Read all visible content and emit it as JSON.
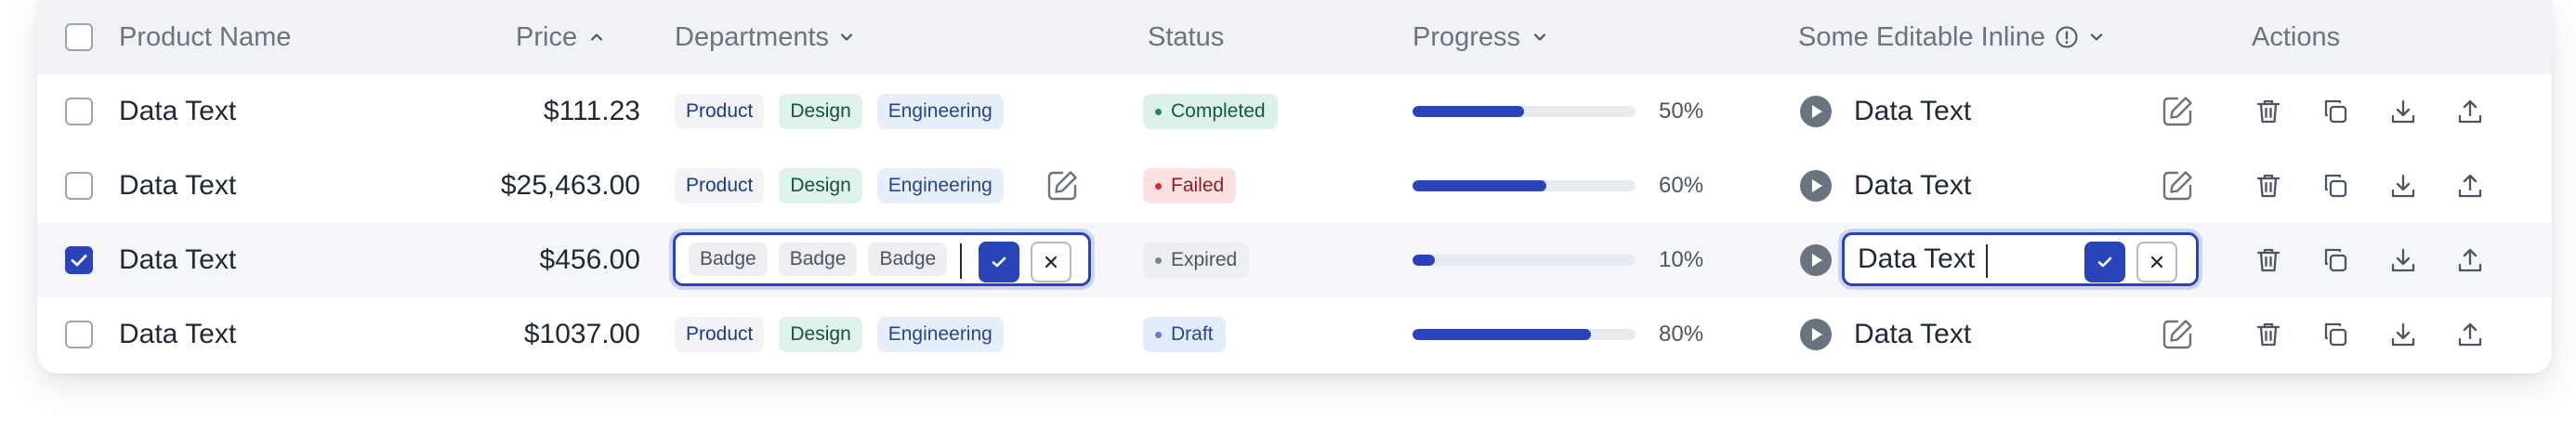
{
  "headers": {
    "product_name": "Product Name",
    "price": "Price",
    "departments": "Departments",
    "status": "Status",
    "progress": "Progress",
    "inline": "Some Editable Inline",
    "actions": "Actions"
  },
  "rows": [
    {
      "name": "Data Text",
      "price": "$111.23",
      "departments": [
        "Product",
        "Design",
        "Engineering"
      ],
      "status": "Completed",
      "progress_label": "50%",
      "progress": 0.5,
      "inline_value": "Data Text",
      "checked": false
    },
    {
      "name": "Data Text",
      "price": "$25,463.00",
      "departments": [
        "Product",
        "Design",
        "Engineering"
      ],
      "status": "Failed",
      "progress_label": "60%",
      "progress": 0.6,
      "inline_value": "Data Text",
      "checked": false
    },
    {
      "name": "Data Text",
      "price": "$456.00",
      "departments_editing": [
        "Badge",
        "Badge",
        "Badge"
      ],
      "status": "Expired",
      "progress_label": "10%",
      "progress": 0.1,
      "inline_value": "Data Text",
      "checked": true
    },
    {
      "name": "Data Text",
      "price": "$1037.00",
      "departments": [
        "Product",
        "Design",
        "Engineering"
      ],
      "status": "Draft",
      "progress_label": "80%",
      "progress": 0.8,
      "inline_value": "Data Text",
      "checked": false
    }
  ],
  "icons": {
    "sort": "chevron-up-icon",
    "dropdown": "chevron-down-icon",
    "info": "info-icon",
    "play": "play-icon",
    "edit": "edit-icon",
    "delete": "trash-icon",
    "copy": "copy-icon",
    "download": "download-icon",
    "upload": "upload-icon",
    "confirm": "check-icon",
    "cancel": "close-icon"
  },
  "colors": {
    "accent": "#2944b8",
    "header_bg": "#f1f2f5",
    "selected_row_bg": "#f5f6f9"
  }
}
